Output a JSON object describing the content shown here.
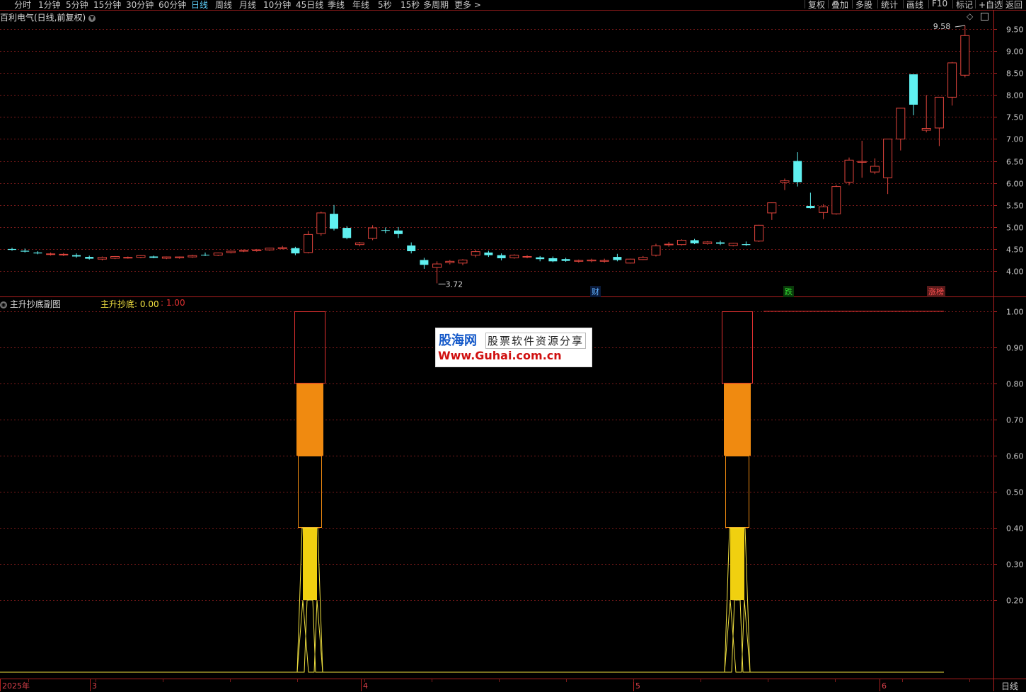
{
  "toolbar": {
    "periods": [
      "分时",
      "1分钟",
      "5分钟",
      "15分钟",
      "30分钟",
      "60分钟",
      "日线",
      "周线",
      "月线",
      "10分钟",
      "45日线",
      "季线",
      "年线",
      "5秒",
      "15秒",
      "多周期",
      "更多 >"
    ],
    "active": "日线",
    "right_buttons": [
      "复权",
      "叠加",
      "多股",
      "统计",
      "画线",
      "F10",
      "标记",
      "+自选",
      "返回"
    ]
  },
  "main_chart": {
    "title": "百利电气(日线,前复权)",
    "y_ticks": [
      "9.50",
      "9.00",
      "8.50",
      "8.00",
      "7.50",
      "7.00",
      "6.50",
      "6.00",
      "5.50",
      "5.00",
      "4.50",
      "4.00"
    ],
    "high_label": "9.58",
    "low_label": "3.72",
    "events": [
      {
        "label": "财",
        "color": "#5fb0ff"
      },
      {
        "label": "跌",
        "color": "#33dd33"
      },
      {
        "label": "涨榜",
        "color": "#ff5050"
      }
    ],
    "colors": {
      "up": "#e0443c",
      "down": "#5ff0f0",
      "grid": "#7a1a1a"
    }
  },
  "chart_data": [
    {
      "type": "candlestick",
      "title": "百利电气(日线,前复权)",
      "ylim": [
        3.6,
        9.7
      ],
      "x_labels": [
        "2025年",
        "3",
        "4",
        "5",
        "6"
      ],
      "candles": [
        [
          4.5,
          4.53,
          4.46,
          4.48
        ],
        [
          4.46,
          4.51,
          4.42,
          4.44
        ],
        [
          4.42,
          4.45,
          4.38,
          4.4
        ],
        [
          4.38,
          4.42,
          4.35,
          4.39
        ],
        [
          4.37,
          4.41,
          4.34,
          4.38
        ],
        [
          4.36,
          4.4,
          4.3,
          4.33
        ],
        [
          4.32,
          4.35,
          4.26,
          4.28
        ],
        [
          4.27,
          4.33,
          4.24,
          4.31
        ],
        [
          4.29,
          4.34,
          4.27,
          4.33
        ],
        [
          4.3,
          4.33,
          4.28,
          4.31
        ],
        [
          4.31,
          4.36,
          4.29,
          4.35
        ],
        [
          4.33,
          4.35,
          4.29,
          4.3
        ],
        [
          4.29,
          4.33,
          4.27,
          4.32
        ],
        [
          4.3,
          4.33,
          4.28,
          4.32
        ],
        [
          4.32,
          4.37,
          4.3,
          4.35
        ],
        [
          4.37,
          4.42,
          4.34,
          4.36
        ],
        [
          4.36,
          4.42,
          4.34,
          4.41
        ],
        [
          4.42,
          4.46,
          4.4,
          4.45
        ],
        [
          4.45,
          4.49,
          4.43,
          4.47
        ],
        [
          4.46,
          4.5,
          4.44,
          4.48
        ],
        [
          4.48,
          4.53,
          4.46,
          4.52
        ],
        [
          4.51,
          4.57,
          4.49,
          4.53
        ],
        [
          4.52,
          4.55,
          4.36,
          4.4
        ],
        [
          4.42,
          4.91,
          4.4,
          4.83
        ],
        [
          4.85,
          5.35,
          4.8,
          5.32
        ],
        [
          5.3,
          5.5,
          4.92,
          4.96
        ],
        [
          4.98,
          5.02,
          4.72,
          4.75
        ],
        [
          4.6,
          4.66,
          4.56,
          4.64
        ],
        [
          4.74,
          5.04,
          4.7,
          4.98
        ],
        [
          4.93,
          4.99,
          4.86,
          4.92
        ],
        [
          4.92,
          5.0,
          4.75,
          4.84
        ],
        [
          4.58,
          4.65,
          4.4,
          4.45
        ],
        [
          4.25,
          4.3,
          4.05,
          4.14
        ],
        [
          4.08,
          4.22,
          3.72,
          4.16
        ],
        [
          4.19,
          4.25,
          4.15,
          4.22
        ],
        [
          4.18,
          4.27,
          4.13,
          4.25
        ],
        [
          4.36,
          4.48,
          4.31,
          4.44
        ],
        [
          4.42,
          4.46,
          4.32,
          4.36
        ],
        [
          4.36,
          4.4,
          4.24,
          4.29
        ],
        [
          4.3,
          4.38,
          4.28,
          4.36
        ],
        [
          4.32,
          4.36,
          4.29,
          4.33
        ],
        [
          4.31,
          4.34,
          4.22,
          4.27
        ],
        [
          4.29,
          4.33,
          4.2,
          4.22
        ],
        [
          4.27,
          4.3,
          4.21,
          4.23
        ],
        [
          4.22,
          4.26,
          4.19,
          4.24
        ],
        [
          4.23,
          4.28,
          4.2,
          4.25
        ],
        [
          4.22,
          4.28,
          4.19,
          4.24
        ],
        [
          4.32,
          4.39,
          4.22,
          4.25
        ],
        [
          4.18,
          4.28,
          4.17,
          4.27
        ],
        [
          4.26,
          4.34,
          4.25,
          4.31
        ],
        [
          4.36,
          4.62,
          4.33,
          4.57
        ],
        [
          4.6,
          4.66,
          4.55,
          4.61
        ],
        [
          4.6,
          4.72,
          4.58,
          4.7
        ],
        [
          4.7,
          4.73,
          4.61,
          4.63
        ],
        [
          4.62,
          4.68,
          4.6,
          4.66
        ],
        [
          4.65,
          4.69,
          4.59,
          4.62
        ],
        [
          4.58,
          4.64,
          4.56,
          4.63
        ],
        [
          4.61,
          4.67,
          4.57,
          4.59
        ],
        [
          4.68,
          5.05,
          4.66,
          5.04
        ],
        [
          5.32,
          5.56,
          5.16,
          5.55
        ],
        [
          6.02,
          6.1,
          5.84,
          6.05
        ],
        [
          6.5,
          6.7,
          5.92,
          6.02
        ],
        [
          5.48,
          5.78,
          5.42,
          5.43
        ],
        [
          5.33,
          5.52,
          5.18,
          5.46
        ],
        [
          5.3,
          5.96,
          5.28,
          5.92
        ],
        [
          6.02,
          6.58,
          5.95,
          6.52
        ],
        [
          6.47,
          6.96,
          6.12,
          6.49
        ],
        [
          6.25,
          6.56,
          6.2,
          6.38
        ],
        [
          6.12,
          7.0,
          5.75,
          7.0
        ],
        [
          7.0,
          7.7,
          6.74,
          7.7
        ],
        [
          8.47,
          8.47,
          7.54,
          7.78
        ],
        [
          7.2,
          8.0,
          7.15,
          7.24
        ],
        [
          7.25,
          7.95,
          6.84,
          7.95
        ],
        [
          7.95,
          8.75,
          7.76,
          8.73
        ],
        [
          8.45,
          9.58,
          8.4,
          9.35
        ]
      ]
    },
    {
      "type": "bar",
      "title": "主升抄底副图",
      "series": [
        {
          "name": "主升抄底",
          "values_at_last": 0.0
        }
      ],
      "y_ticks": [
        1.0,
        0.9,
        0.8,
        0.7,
        0.6,
        0.5,
        0.4,
        0.3,
        0.2
      ],
      "ylim": [
        0.0,
        1.0
      ],
      "signals": [
        {
          "segments": [
            {
              "from": 0.8,
              "to": 1.0,
              "color": "#e03030",
              "style": "outline"
            },
            {
              "from": 0.6,
              "to": 0.8,
              "color": "#f08a10",
              "style": "filled"
            },
            {
              "from": 0.4,
              "to": 0.6,
              "color": "#f08a10",
              "style": "outline"
            },
            {
              "from": 0.2,
              "to": 0.4,
              "color": "#f0d010",
              "style": "filled"
            }
          ]
        },
        {
          "segments": [
            {
              "from": 0.8,
              "to": 1.0,
              "color": "#e03030",
              "style": "outline"
            },
            {
              "from": 0.6,
              "to": 0.8,
              "color": "#f08a10",
              "style": "filled"
            },
            {
              "from": 0.4,
              "to": 0.6,
              "color": "#f08a10",
              "style": "outline"
            },
            {
              "from": 0.2,
              "to": 0.4,
              "color": "#f0d010",
              "style": "filled"
            }
          ]
        }
      ]
    }
  ],
  "sub_chart": {
    "title": "主升抄底副图",
    "label": "主升抄底:",
    "value": "0.00",
    "value2": ": 1.00"
  },
  "x_axis": {
    "labels": [
      "2025年",
      "3",
      "4",
      "5",
      "6"
    ],
    "period_tag": "日线"
  },
  "watermark": {
    "line1": "股海网",
    "line1b": "股票软件资源分享",
    "line2": "Www.Guhai.com.cn"
  }
}
